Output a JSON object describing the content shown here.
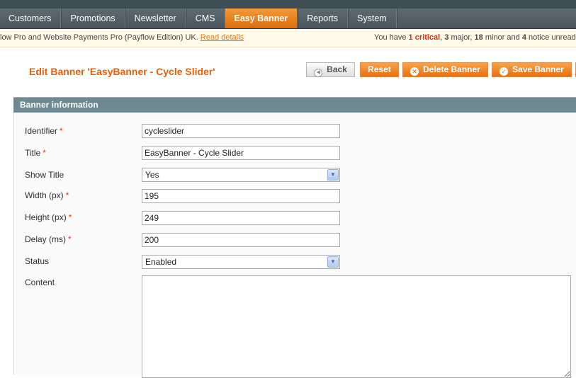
{
  "nav": {
    "items": [
      {
        "label": "Customers"
      },
      {
        "label": "Promotions"
      },
      {
        "label": "Newsletter"
      },
      {
        "label": "CMS"
      },
      {
        "label": "Easy Banner"
      },
      {
        "label": "Reports"
      },
      {
        "label": "System"
      }
    ],
    "active_index": 4
  },
  "notice": {
    "left_text": "low Pro and Website Payments Pro (Payflow Edition) UK.",
    "link": "Read details",
    "right_prefix": "You have",
    "critical_count": "1",
    "critical_label": "critical",
    "major_count": "3",
    "major_label": "major",
    "minor_count": "18",
    "minor_label": "minor and",
    "notice_count": "4",
    "notice_label": "notice unread m"
  },
  "page": {
    "title": "Edit Banner 'EasyBanner - Cycle Slider'"
  },
  "buttons": {
    "back": "Back",
    "reset": "Reset",
    "delete": "Delete Banner",
    "save": "Save Banner"
  },
  "section": {
    "title": "Banner information"
  },
  "form": {
    "identifier": {
      "label": "Identifier",
      "required": "*",
      "value": "cycleslider"
    },
    "title": {
      "label": "Title",
      "required": "*",
      "value": "EasyBanner - Cycle Slider"
    },
    "show_title": {
      "label": "Show Title",
      "value": "Yes"
    },
    "width": {
      "label": "Width (px)",
      "required": "*",
      "value": "195"
    },
    "height": {
      "label": "Height (px)",
      "required": "*",
      "value": "249"
    },
    "delay": {
      "label": "Delay (ms)",
      "required": "*",
      "value": "200"
    },
    "status": {
      "label": "Status",
      "value": "Enabled"
    },
    "content": {
      "label": "Content",
      "value": ""
    }
  },
  "colors": {
    "accent": "#eb5e00",
    "nav_bg": "#4a565d",
    "section_header": "#6f8992"
  },
  "icons": {
    "back": "back-arrow-icon",
    "delete": "delete-icon",
    "save": "check-icon",
    "select_arrow": "chevron-down-icon"
  }
}
